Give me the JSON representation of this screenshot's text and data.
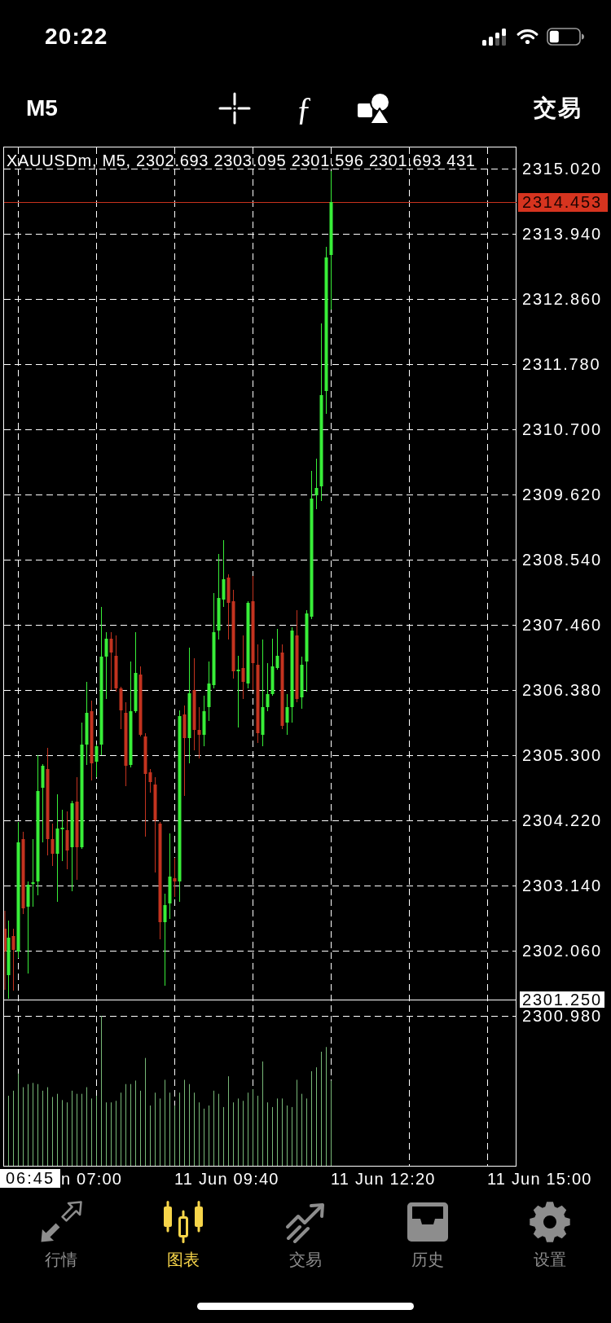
{
  "status_bar": {
    "time": "20:22"
  },
  "toolbar": {
    "timeframe": "M5",
    "indicator_glyph": "ƒ",
    "trade": "交易"
  },
  "chart": {
    "header": "XAUUSDm, M5, 2302.693 2303.095 2301.596 2301.693 431",
    "price_labels": [
      "2315.020",
      "2313.940",
      "2312.860",
      "2311.780",
      "2310.700",
      "2309.620",
      "2308.540",
      "2307.460",
      "2306.380",
      "2305.300",
      "2304.220",
      "2303.140",
      "2302.060",
      "2300.980"
    ],
    "current_price": "2314.453",
    "level_price": "2301.250",
    "start_time": "06:45",
    "time_labels": [
      "n 07:00",
      "11 Jun 09:40",
      "11 Jun 12:20",
      "11 Jun 15:00"
    ]
  },
  "tabs": [
    {
      "label": "行情",
      "selected": false
    },
    {
      "label": "图表",
      "selected": true
    },
    {
      "label": "交易",
      "selected": false
    },
    {
      "label": "历史",
      "selected": false
    },
    {
      "label": "设置",
      "selected": false
    }
  ]
}
